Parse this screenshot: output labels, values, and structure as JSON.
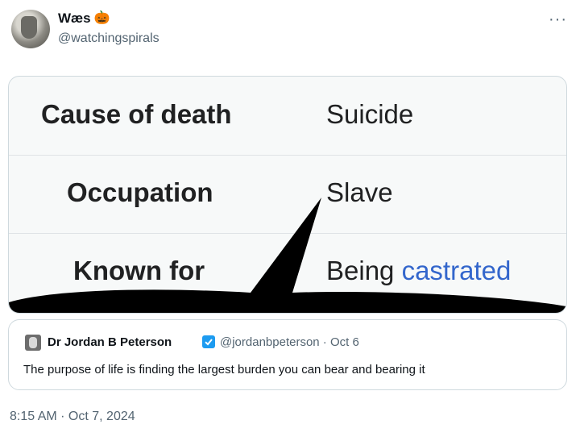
{
  "author": {
    "display_name": "Wæs",
    "name_emoji": "🎃",
    "handle": "@watchingspirals"
  },
  "more_glyph": "···",
  "table": {
    "rows": [
      {
        "label": "Cause of death",
        "value": "Suicide",
        "value_is_link": true
      },
      {
        "label": "Occupation",
        "value": "Slave",
        "value_is_link": false
      },
      {
        "label": "Known for",
        "value_prefix": "Being ",
        "value_link": "castrated"
      }
    ]
  },
  "quoted_tweet": {
    "author_name": "Dr Jordan B Peterson",
    "verified": true,
    "handle_and_date": "@jordanbpeterson · Oct 6",
    "text": "The purpose of life is finding the largest burden you can bear and bearing it"
  },
  "timestamp": "8:15 AM · Oct 7, 2024",
  "colors": {
    "link": "#3366cc",
    "verified": "#1d9bf0",
    "muted": "#536471"
  }
}
